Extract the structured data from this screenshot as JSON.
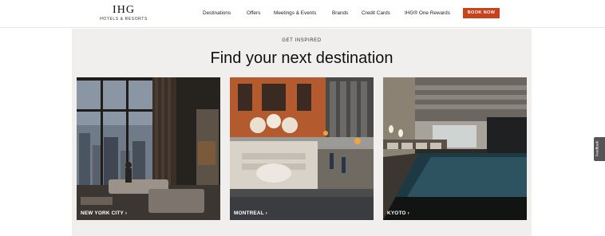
{
  "brand": {
    "logo_main": "IHG",
    "logo_sub": "HOTELS & RESORTS"
  },
  "nav": {
    "items": [
      {
        "label": "Destinations"
      },
      {
        "label": "Offers"
      },
      {
        "label": "Meetings & Events"
      },
      {
        "label": "Brands"
      },
      {
        "label": "Credit Cards"
      },
      {
        "label": "IHG® One Rewards"
      }
    ],
    "book_now": "BOOK NOW"
  },
  "section": {
    "eyebrow": "GET INSPIRED",
    "headline": "Find your next destination"
  },
  "destinations": [
    {
      "label": "NEW YORK CITY ›"
    },
    {
      "label": "MONTREAL ›"
    },
    {
      "label": "KYOTO ›"
    }
  ],
  "feedback": {
    "label": "Feedback"
  },
  "colors": {
    "accent": "#c8421b",
    "section_bg": "#f0efed"
  }
}
